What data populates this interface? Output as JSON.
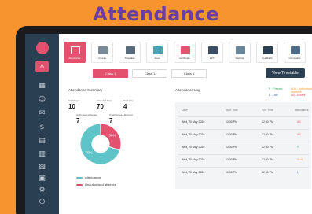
{
  "poster": {
    "title": "Attendance"
  },
  "toolbar": {
    "items": [
      {
        "label": "Attendance",
        "icon": "calendar-icon",
        "active": true,
        "color": "#ffffff"
      },
      {
        "label": "Course",
        "icon": "course-icon",
        "active": false,
        "color": "#7a8b99"
      },
      {
        "label": "Timetable",
        "icon": "timetable-icon",
        "active": false,
        "color": "#5a6b7b"
      },
      {
        "label": "Fees",
        "icon": "fees-icon",
        "active": false,
        "color": "#4aa3b5"
      },
      {
        "label": "Certificate",
        "icon": "certificate-icon",
        "active": false,
        "color": "#e2526f"
      },
      {
        "label": "EFT",
        "icon": "eft-icon",
        "active": false,
        "color": "#3d5063"
      },
      {
        "label": "Referral",
        "icon": "referral-icon",
        "active": false,
        "color": "#6a8799"
      },
      {
        "label": "Feedback",
        "icon": "feedback-icon",
        "active": false,
        "color": "#2a3f52"
      },
      {
        "label": "Complaints",
        "icon": "complaints-icon",
        "active": false,
        "color": "#4b6b88"
      }
    ]
  },
  "classes": {
    "tabs": [
      "Class 1",
      "Class 1",
      "Class 1"
    ],
    "view_timetable": "View Timetable"
  },
  "summary": {
    "title": "Attendance Summary",
    "stats": [
      {
        "label": "Total Days",
        "value": "10"
      },
      {
        "label": "Attended Days",
        "value": "70"
      },
      {
        "label": "Total Late",
        "value": "4"
      }
    ],
    "absences": [
      {
        "label": "Authorised Absence",
        "value": "7"
      },
      {
        "label": "Unauthorised Absence",
        "value": "7"
      }
    ],
    "donut": {
      "slices": [
        {
          "label": "Attendance",
          "percent": 70,
          "display": "70%",
          "color": "#5ec4c9"
        },
        {
          "label": "Unauthorised absence",
          "percent": 30,
          "display": "30%",
          "color": "#e2526f"
        }
      ]
    }
  },
  "log": {
    "title": "Attendance Log",
    "key": [
      {
        "label": "P - Present",
        "color": "#3fae6d"
      },
      {
        "label": "AUA - Authorised Absence",
        "color": "#f7942d"
      },
      {
        "label": "L - Late",
        "color": "#3f6bb5"
      },
      {
        "label": "AB - Absent",
        "color": "#e2526f"
      }
    ],
    "columns": [
      "Date",
      "Start Time",
      "End Time",
      "Attendance"
    ],
    "rows": [
      {
        "date": "Wed, 20 May 2020",
        "start": "12:30 PM",
        "end": "12:30 PM",
        "status": "AB",
        "color": "#e2526f"
      },
      {
        "date": "Wed, 20 May 2020",
        "start": "12:30 PM",
        "end": "12:30 PM",
        "status": "AB",
        "color": "#e2526f"
      },
      {
        "date": "Wed, 20 May 2020",
        "start": "12:30 PM",
        "end": "12:30 PM",
        "status": "P",
        "color": "#3fae6d"
      },
      {
        "date": "Wed, 20 May 2020",
        "start": "12:30 PM",
        "end": "12:30 PM",
        "status": "AUA",
        "color": "#f7942d"
      },
      {
        "date": "Wed, 20 May 2020",
        "start": "12:30 PM",
        "end": "12:30 PM",
        "status": "L",
        "color": "#3f6bb5"
      }
    ]
  },
  "sidebar": {
    "icons": [
      "home-icon",
      "calendar-icon",
      "user-icon",
      "chat-icon",
      "dollar-icon",
      "book-icon",
      "document-icon",
      "clipboard-icon",
      "grid-icon",
      "settings-icon",
      "logout-icon"
    ]
  }
}
